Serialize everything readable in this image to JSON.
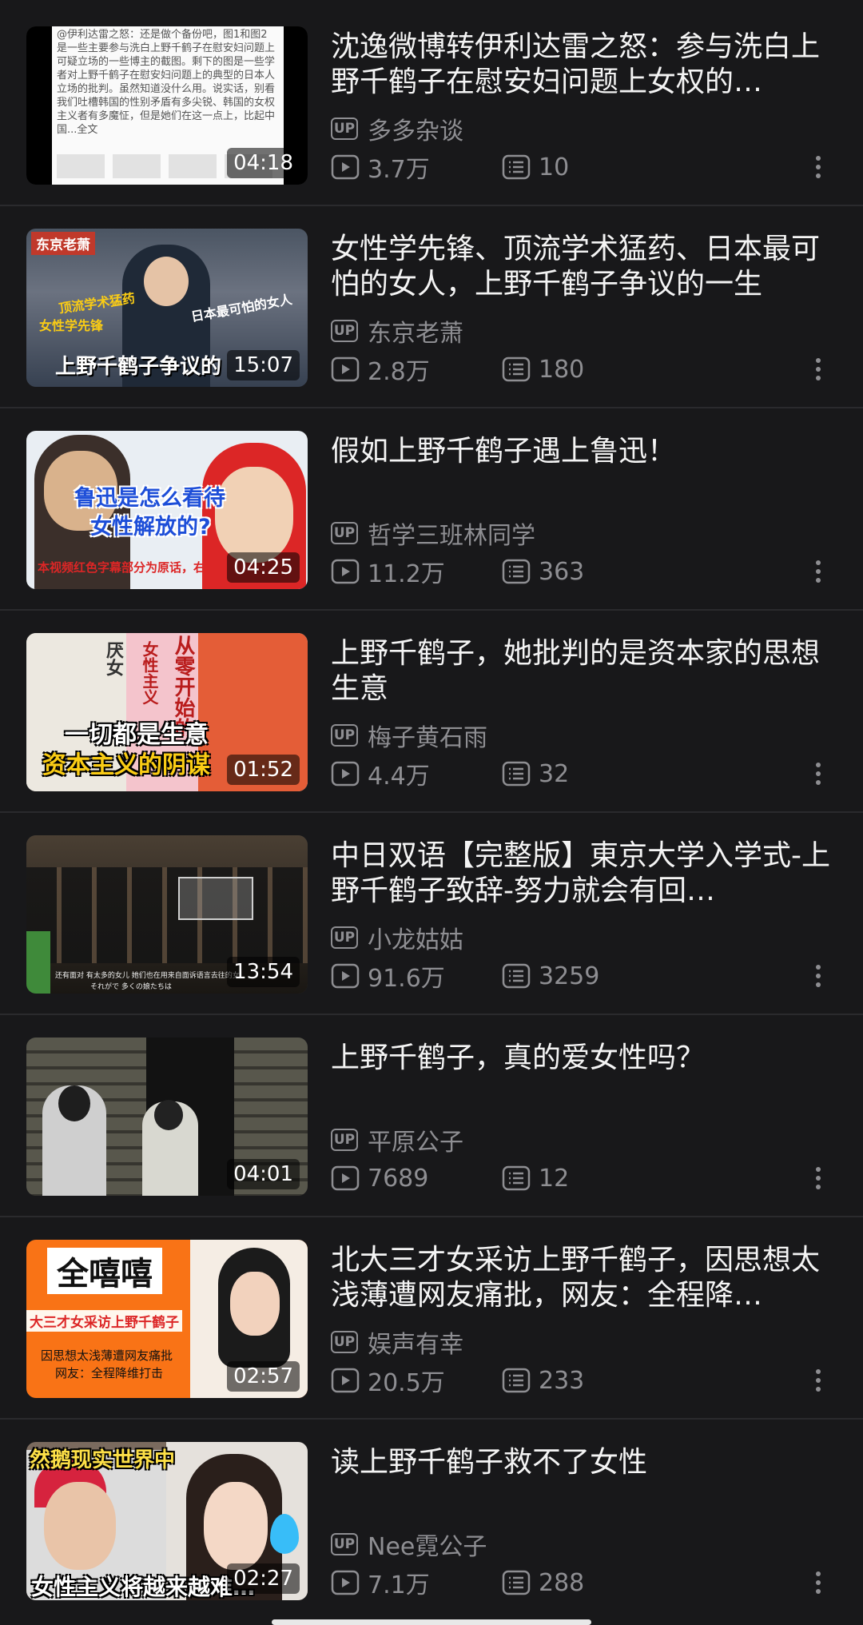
{
  "videos": [
    {
      "title": "沈逸微博转伊利达雷之怒：参与洗白上野千鹤子在慰安妇问题上女权的…",
      "uploader": "多多杂谈",
      "views": "3.7万",
      "comments": "10",
      "duration": "04:18",
      "thumb_text": "@伊利达雷之怒：还是做个备份吧，图1和图2是一些主要参与洗白上野千鹤子在慰安妇问题上可疑立场的一些博主的截图。剩下的图是一些学者对上野千鹤子在慰安妇问题上的典型的日本人立场的批判。虽然知道没什么用。说实话，别看我们吐槽韩国的性别矛盾有多尖锐、韩国的女权主义者有多魔怔，但是她们在这一点上，比起中国...全文"
    },
    {
      "title": "女性学先锋、顶流学术猛药、日本最可怕的女人，上野千鹤子争议的一生",
      "uploader": "东京老萧",
      "views": "2.8万",
      "comments": "180",
      "duration": "15:07",
      "thumb_text": [
        "东京老萧",
        "顶流学术猛药",
        "女性学先锋",
        "日本最可怕的女人",
        "上野千鹤子争议的"
      ]
    },
    {
      "title": "假如上野千鹤子遇上鲁迅！",
      "uploader": "哲学三班林同学",
      "views": "11.2万",
      "comments": "363",
      "duration": "04:25",
      "thumb_text": [
        "鲁迅是怎么看待",
        "女性解放的?",
        "本视频红色字幕部分为原话，右"
      ]
    },
    {
      "title": "上野千鹤子，她批判的是资本家的思想生意",
      "uploader": "梅子黄石雨",
      "views": "4.4万",
      "comments": "32",
      "duration": "01:52",
      "thumb_text": [
        "一切都是生意",
        "资本主义的阴谋",
        "从零开始的",
        "女性主义",
        "厌女"
      ]
    },
    {
      "title": "中日双语【完整版】東京大学入学式-上野千鹤子致辞-努力就会有回…",
      "uploader": "小龙姑姑",
      "views": "91.6万",
      "comments": "3259",
      "duration": "13:54",
      "thumb_text": [
        "还有面对 有太多的女儿 她们也在用来自面诉语言去往的女",
        "それがで 多くの娘たちは"
      ]
    },
    {
      "title": "上野千鹤子，真的爱女性吗？",
      "uploader": "平原公子",
      "views": "7689",
      "comments": "12",
      "duration": "04:01",
      "thumb_text": []
    },
    {
      "title": "北大三才女采访上野千鹤子，因思想太浅薄遭网友痛批，网友：全程降…",
      "uploader": "娱声有幸",
      "views": "20.5万",
      "comments": "233",
      "duration": "02:57",
      "thumb_text": [
        "全嘻嘻",
        "大三才女采访上野千鹤子",
        "因思想太浅薄遭网友痛批",
        "网友：全程降维打击"
      ]
    },
    {
      "title": "读上野千鹤子救不了女性",
      "uploader": "Nee霓公子",
      "views": "7.1万",
      "comments": "288",
      "duration": "02:27",
      "thumb_text": [
        "然鹅现实世界中",
        "女性主义将越来越难…"
      ]
    }
  ],
  "up_badge_label": "UP",
  "icons": {
    "views": "play-count-icon",
    "comments": "danmaku-icon",
    "more": "more-vertical-icon"
  },
  "colors": {
    "background": "#18181a",
    "secondary_text": "#8e8e92",
    "separator": "#2a2a2d"
  }
}
